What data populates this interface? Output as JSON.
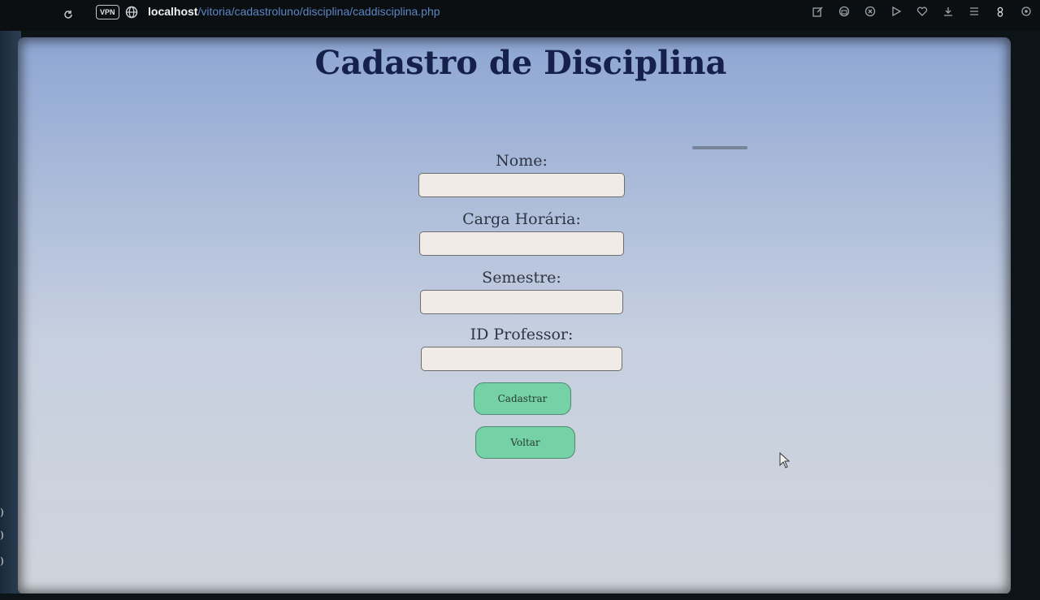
{
  "browser": {
    "vpn_label": "VPN",
    "url_host": "localhost",
    "url_path": "/vitoria/cadastroluno/disciplina/caddisciplina.php",
    "icons": [
      "reload-icon",
      "vpn-icon",
      "globe-icon",
      "edit-icon",
      "camera-icon",
      "close-circle-icon",
      "play-icon",
      "heart-icon",
      "download-icon",
      "menu-icon",
      "user-icon",
      "settings-icon"
    ]
  },
  "page": {
    "title": "Cadastro de Disciplina"
  },
  "form": {
    "fields": [
      {
        "label": "Nome:",
        "value": ""
      },
      {
        "label": "Carga Horária:",
        "value": ""
      },
      {
        "label": "Semestre:",
        "value": ""
      },
      {
        "label": "ID Professor:",
        "value": ""
      }
    ],
    "submit_label": "Cadastrar",
    "back_label": "Voltar"
  },
  "colors": {
    "button_bg": "#74d2a6",
    "input_bg": "#f0ebe6",
    "title_color": "#15214a"
  }
}
